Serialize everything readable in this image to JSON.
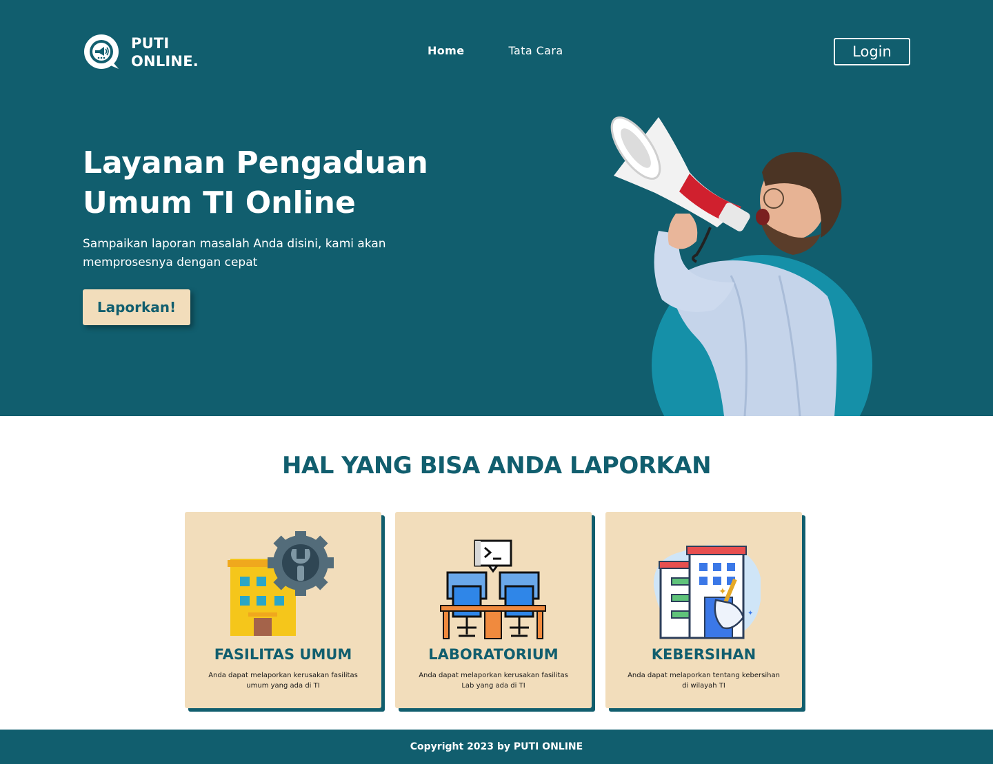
{
  "header": {
    "logo_line1": "PUTI",
    "logo_line2": "ONLINE.",
    "nav": [
      {
        "label": "Home",
        "active": true
      },
      {
        "label": "Tata Cara",
        "active": false
      }
    ],
    "login_label": "Login"
  },
  "hero": {
    "title": "Layanan Pengaduan Umum TI Online",
    "subtitle": "Sampaikan laporan masalah Anda disini, kami akan memprosesnya dengan cepat",
    "cta_label": "Laporkan!",
    "image_icon": "man-megaphone-illustration"
  },
  "section": {
    "title": "HAL YANG BISA ANDA LAPORKAN",
    "cards": [
      {
        "title": "FASILITAS UMUM",
        "desc": "Anda dapat melaporkan kerusakan fasilitas umum yang ada di TI",
        "icon": "building-gear-icon"
      },
      {
        "title": "LABORATORIUM",
        "desc": "Anda dapat melaporkan kerusakan fasilitas Lab yang ada di TI",
        "icon": "computer-lab-icon"
      },
      {
        "title": "KEBERSIHAN",
        "desc": "Anda dapat melaporkan tentang kebersihan di wilayah TI",
        "icon": "clean-building-icon"
      }
    ]
  },
  "footer": {
    "copyright": "Copyright 2023 by PUTI ONLINE"
  },
  "colors": {
    "primary": "#115e6e",
    "accent": "#1590a8",
    "card_bg": "#f2ddbb"
  }
}
